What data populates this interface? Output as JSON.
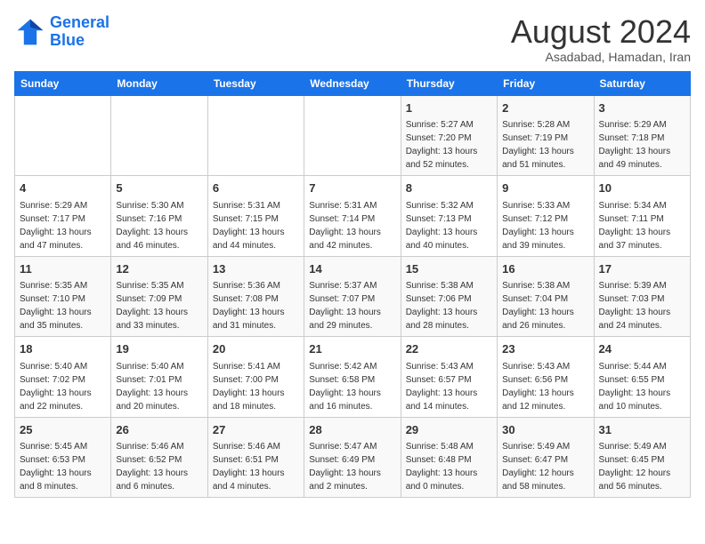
{
  "header": {
    "logo_line1": "General",
    "logo_line2": "Blue",
    "month_title": "August 2024",
    "subtitle": "Asadabad, Hamadan, Iran"
  },
  "weekdays": [
    "Sunday",
    "Monday",
    "Tuesday",
    "Wednesday",
    "Thursday",
    "Friday",
    "Saturday"
  ],
  "weeks": [
    [
      {
        "day": "",
        "info": ""
      },
      {
        "day": "",
        "info": ""
      },
      {
        "day": "",
        "info": ""
      },
      {
        "day": "",
        "info": ""
      },
      {
        "day": "1",
        "info": "Sunrise: 5:27 AM\nSunset: 7:20 PM\nDaylight: 13 hours\nand 52 minutes."
      },
      {
        "day": "2",
        "info": "Sunrise: 5:28 AM\nSunset: 7:19 PM\nDaylight: 13 hours\nand 51 minutes."
      },
      {
        "day": "3",
        "info": "Sunrise: 5:29 AM\nSunset: 7:18 PM\nDaylight: 13 hours\nand 49 minutes."
      }
    ],
    [
      {
        "day": "4",
        "info": "Sunrise: 5:29 AM\nSunset: 7:17 PM\nDaylight: 13 hours\nand 47 minutes."
      },
      {
        "day": "5",
        "info": "Sunrise: 5:30 AM\nSunset: 7:16 PM\nDaylight: 13 hours\nand 46 minutes."
      },
      {
        "day": "6",
        "info": "Sunrise: 5:31 AM\nSunset: 7:15 PM\nDaylight: 13 hours\nand 44 minutes."
      },
      {
        "day": "7",
        "info": "Sunrise: 5:31 AM\nSunset: 7:14 PM\nDaylight: 13 hours\nand 42 minutes."
      },
      {
        "day": "8",
        "info": "Sunrise: 5:32 AM\nSunset: 7:13 PM\nDaylight: 13 hours\nand 40 minutes."
      },
      {
        "day": "9",
        "info": "Sunrise: 5:33 AM\nSunset: 7:12 PM\nDaylight: 13 hours\nand 39 minutes."
      },
      {
        "day": "10",
        "info": "Sunrise: 5:34 AM\nSunset: 7:11 PM\nDaylight: 13 hours\nand 37 minutes."
      }
    ],
    [
      {
        "day": "11",
        "info": "Sunrise: 5:35 AM\nSunset: 7:10 PM\nDaylight: 13 hours\nand 35 minutes."
      },
      {
        "day": "12",
        "info": "Sunrise: 5:35 AM\nSunset: 7:09 PM\nDaylight: 13 hours\nand 33 minutes."
      },
      {
        "day": "13",
        "info": "Sunrise: 5:36 AM\nSunset: 7:08 PM\nDaylight: 13 hours\nand 31 minutes."
      },
      {
        "day": "14",
        "info": "Sunrise: 5:37 AM\nSunset: 7:07 PM\nDaylight: 13 hours\nand 29 minutes."
      },
      {
        "day": "15",
        "info": "Sunrise: 5:38 AM\nSunset: 7:06 PM\nDaylight: 13 hours\nand 28 minutes."
      },
      {
        "day": "16",
        "info": "Sunrise: 5:38 AM\nSunset: 7:04 PM\nDaylight: 13 hours\nand 26 minutes."
      },
      {
        "day": "17",
        "info": "Sunrise: 5:39 AM\nSunset: 7:03 PM\nDaylight: 13 hours\nand 24 minutes."
      }
    ],
    [
      {
        "day": "18",
        "info": "Sunrise: 5:40 AM\nSunset: 7:02 PM\nDaylight: 13 hours\nand 22 minutes."
      },
      {
        "day": "19",
        "info": "Sunrise: 5:40 AM\nSunset: 7:01 PM\nDaylight: 13 hours\nand 20 minutes."
      },
      {
        "day": "20",
        "info": "Sunrise: 5:41 AM\nSunset: 7:00 PM\nDaylight: 13 hours\nand 18 minutes."
      },
      {
        "day": "21",
        "info": "Sunrise: 5:42 AM\nSunset: 6:58 PM\nDaylight: 13 hours\nand 16 minutes."
      },
      {
        "day": "22",
        "info": "Sunrise: 5:43 AM\nSunset: 6:57 PM\nDaylight: 13 hours\nand 14 minutes."
      },
      {
        "day": "23",
        "info": "Sunrise: 5:43 AM\nSunset: 6:56 PM\nDaylight: 13 hours\nand 12 minutes."
      },
      {
        "day": "24",
        "info": "Sunrise: 5:44 AM\nSunset: 6:55 PM\nDaylight: 13 hours\nand 10 minutes."
      }
    ],
    [
      {
        "day": "25",
        "info": "Sunrise: 5:45 AM\nSunset: 6:53 PM\nDaylight: 13 hours\nand 8 minutes."
      },
      {
        "day": "26",
        "info": "Sunrise: 5:46 AM\nSunset: 6:52 PM\nDaylight: 13 hours\nand 6 minutes."
      },
      {
        "day": "27",
        "info": "Sunrise: 5:46 AM\nSunset: 6:51 PM\nDaylight: 13 hours\nand 4 minutes."
      },
      {
        "day": "28",
        "info": "Sunrise: 5:47 AM\nSunset: 6:49 PM\nDaylight: 13 hours\nand 2 minutes."
      },
      {
        "day": "29",
        "info": "Sunrise: 5:48 AM\nSunset: 6:48 PM\nDaylight: 13 hours\nand 0 minutes."
      },
      {
        "day": "30",
        "info": "Sunrise: 5:49 AM\nSunset: 6:47 PM\nDaylight: 12 hours\nand 58 minutes."
      },
      {
        "day": "31",
        "info": "Sunrise: 5:49 AM\nSunset: 6:45 PM\nDaylight: 12 hours\nand 56 minutes."
      }
    ]
  ]
}
